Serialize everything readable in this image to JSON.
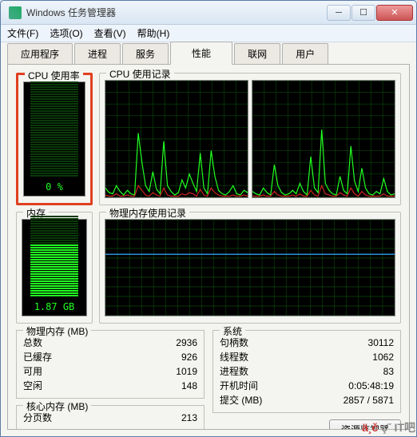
{
  "window": {
    "title": "Windows 任务管理器"
  },
  "menu": {
    "file": "文件(F)",
    "options": "选项(O)",
    "view": "查看(V)",
    "help": "帮助(H)"
  },
  "tabs": [
    "应用程序",
    "进程",
    "服务",
    "性能",
    "联网",
    "用户"
  ],
  "groups": {
    "cpu_usage": "CPU 使用率",
    "cpu_history": "CPU 使用记录",
    "mem_usage": "内存",
    "mem_history": "物理内存使用记录"
  },
  "gauges": {
    "cpu_usage_label": "0 %",
    "cpu_usage_pct": 0,
    "mem_usage_label": "1.87 GB",
    "mem_usage_pct": 64
  },
  "stats": {
    "phys_mem": {
      "title": "物理内存 (MB)",
      "total_label": "总数",
      "total": "2936",
      "cached_label": "已缓存",
      "cached": "926",
      "avail_label": "可用",
      "avail": "1019",
      "free_label": "空闲",
      "free": "148"
    },
    "kernel_mem": {
      "title": "核心内存 (MB)",
      "paged_label": "分页数",
      "paged": "213"
    },
    "system": {
      "title": "系统",
      "handles_label": "句柄数",
      "handles": "30112",
      "threads_label": "线程数",
      "threads": "1062",
      "processes_label": "进程数",
      "processes": "83",
      "uptime_label": "开机时间",
      "uptime": "0:05:48:19",
      "commit_label": "提交 (MB)",
      "commit": "2857 / 5871"
    }
  },
  "buttons": {
    "resource_monitor": "资源监视器"
  },
  "watermark": {
    "left": "ä¸č",
    "right": "ç˝ IT吧"
  },
  "chart_data": {
    "cpu_history": {
      "type": "line",
      "ylim": [
        0,
        100
      ],
      "grid": true,
      "series": [
        {
          "name": "cpu0-usage",
          "color": "#2f2",
          "values": [
            8,
            4,
            3,
            10,
            5,
            2,
            6,
            3,
            2,
            55,
            30,
            10,
            5,
            22,
            7,
            3,
            48,
            10,
            5,
            2,
            4,
            15,
            8,
            20,
            12,
            5,
            38,
            8,
            3,
            40,
            18,
            6,
            3,
            2,
            5,
            10,
            3,
            2,
            6,
            4
          ]
        },
        {
          "name": "cpu0-kernel",
          "color": "#c22",
          "values": [
            2,
            1,
            1,
            3,
            1,
            1,
            2,
            1,
            1,
            10,
            6,
            2,
            1,
            4,
            2,
            1,
            8,
            2,
            1,
            1,
            1,
            3,
            2,
            4,
            3,
            1,
            7,
            2,
            1,
            8,
            4,
            2,
            1,
            1,
            1,
            2,
            1,
            1,
            2,
            1
          ]
        },
        {
          "name": "cpu1-usage",
          "color": "#2f2",
          "values": [
            5,
            3,
            2,
            8,
            4,
            2,
            28,
            10,
            4,
            2,
            3,
            6,
            3,
            12,
            5,
            2,
            35,
            8,
            4,
            58,
            12,
            6,
            3,
            2,
            18,
            6,
            3,
            44,
            14,
            5,
            25,
            8,
            3,
            2,
            5,
            3,
            16,
            5,
            2,
            3
          ]
        },
        {
          "name": "cpu1-kernel",
          "color": "#c22",
          "values": [
            1,
            1,
            1,
            2,
            1,
            1,
            5,
            2,
            1,
            1,
            1,
            2,
            1,
            3,
            1,
            1,
            6,
            2,
            1,
            10,
            3,
            2,
            1,
            1,
            4,
            2,
            1,
            8,
            3,
            1,
            5,
            2,
            1,
            1,
            1,
            1,
            3,
            1,
            1,
            1
          ]
        }
      ]
    },
    "mem_history": {
      "type": "line",
      "ylim": [
        0,
        100
      ],
      "grid": true,
      "series": [
        {
          "name": "mem-used-pct",
          "color": "#3af",
          "values": [
            64,
            64,
            64,
            64,
            64,
            64,
            64,
            64,
            64,
            64,
            64,
            64,
            64,
            64,
            64,
            64,
            64,
            64,
            64,
            64,
            64,
            64,
            64,
            64,
            64,
            64,
            64,
            64,
            64,
            64,
            64,
            64,
            64,
            64,
            64,
            64,
            64,
            64,
            64,
            64
          ]
        }
      ]
    }
  }
}
